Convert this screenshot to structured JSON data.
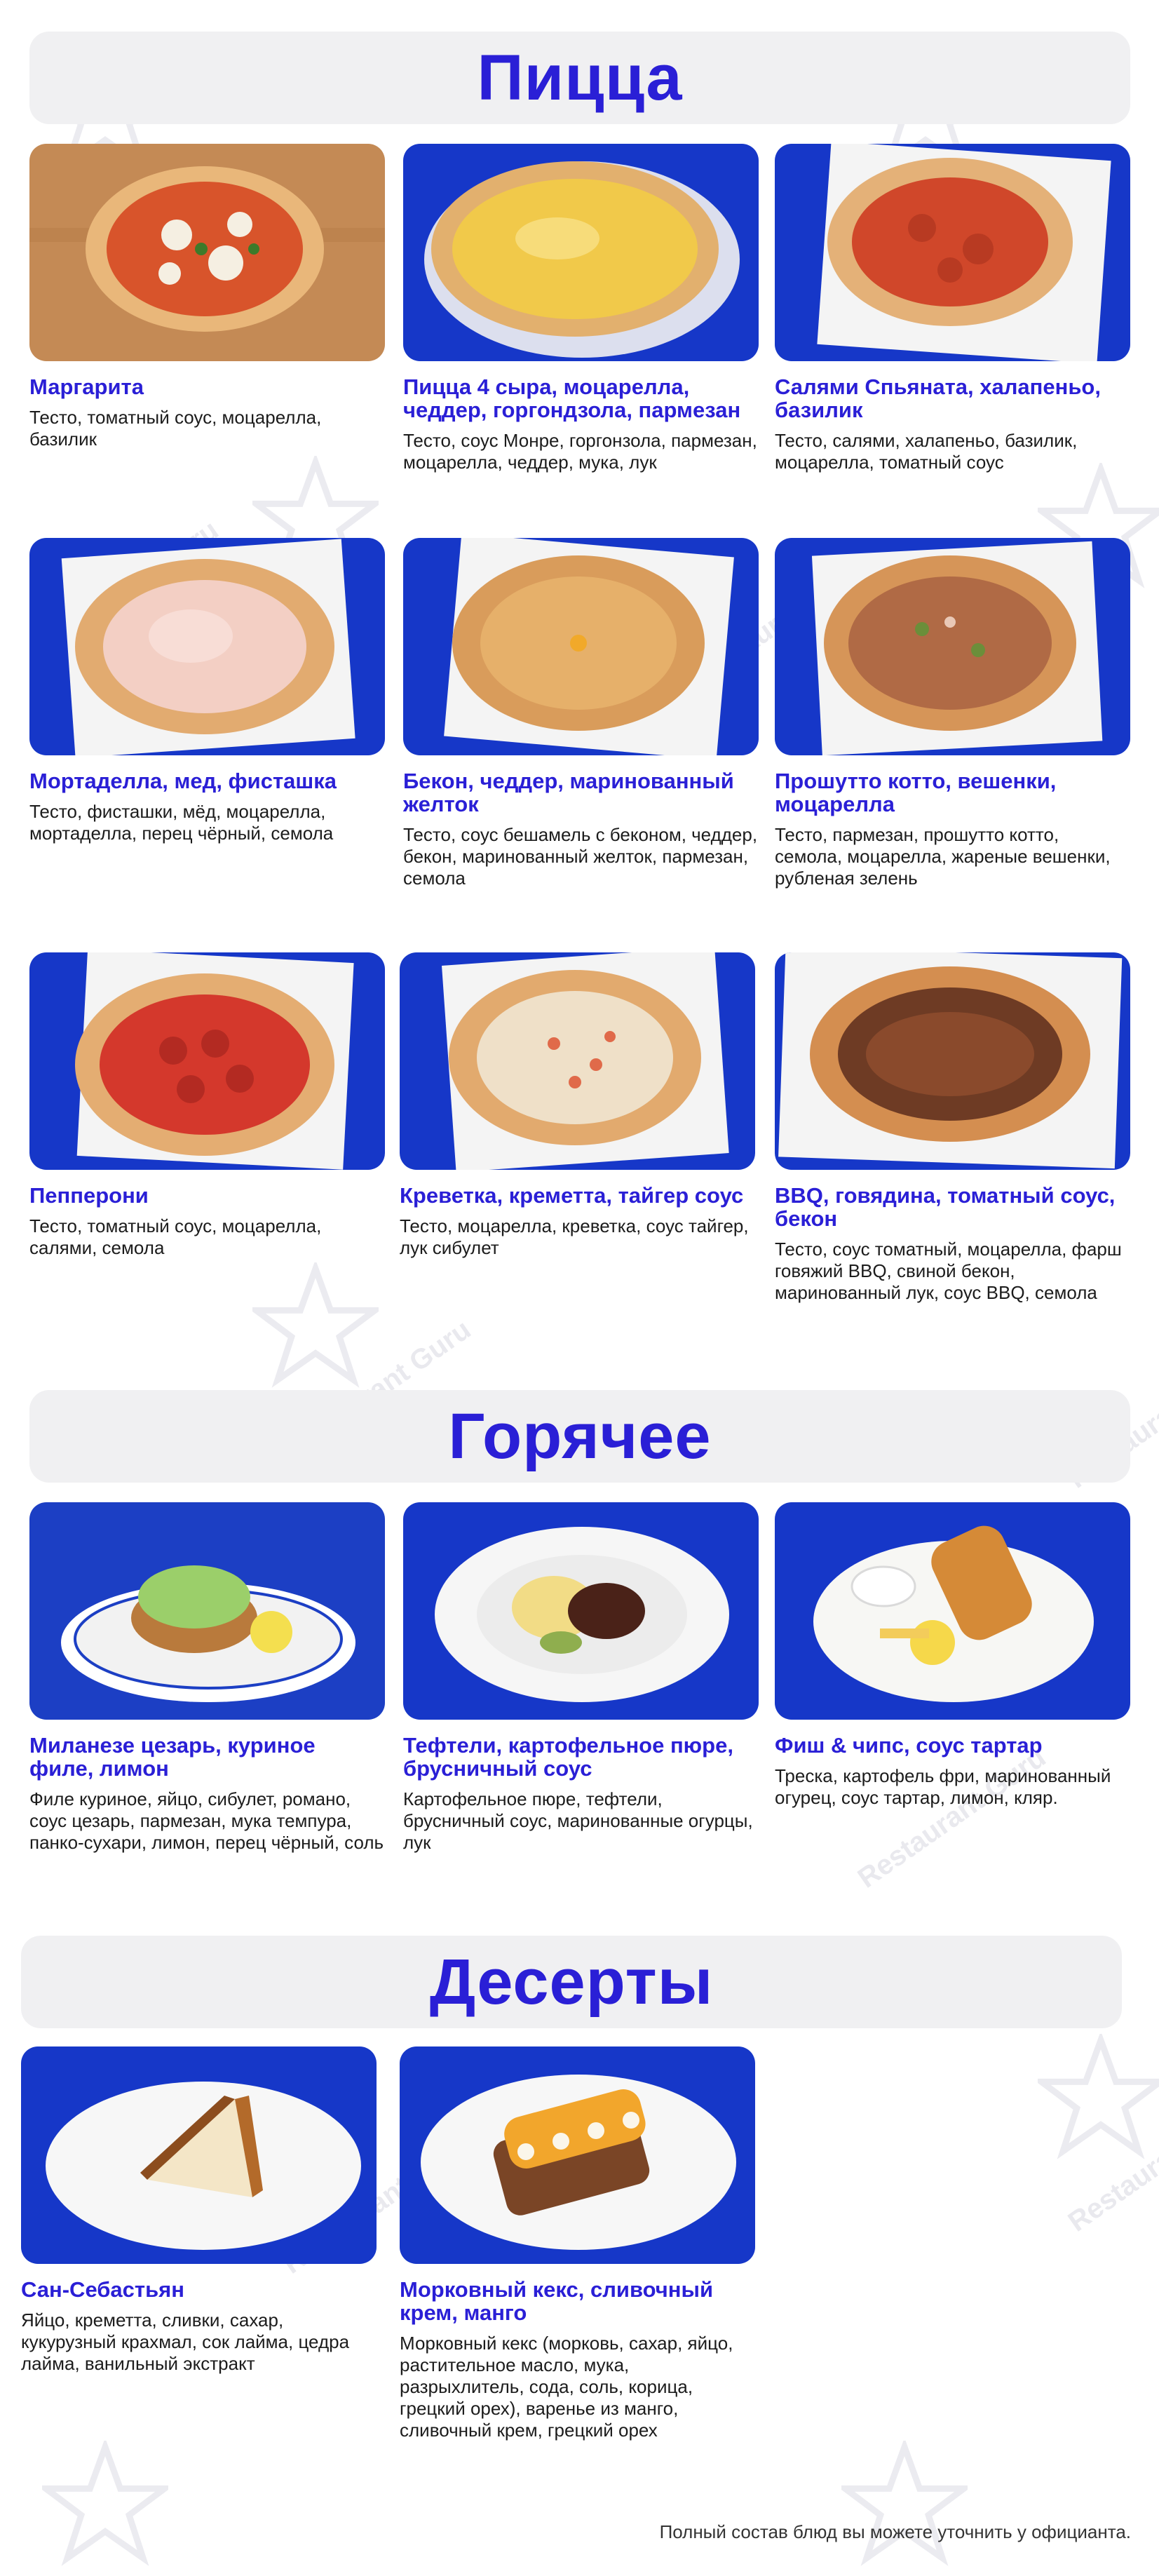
{
  "colors": {
    "accent": "#2a1fd6",
    "header_bg": "#f0f0f2",
    "photo_blue": "#1637c8",
    "text": "#1c1c1c"
  },
  "sections": [
    {
      "title": "Пицца",
      "items": [
        {
          "name": "Маргарита",
          "desc": "Тесто, томатный соус, моцарелла, базилик",
          "image": "pizza-margherita-photo"
        },
        {
          "name": "Пицца 4 сыра, моцарелла, чеддер, горгондзола, пармезан",
          "desc": "Тесто, соус Монре, горгонзола, пармезан, моцарелла, чеддер, мука, лук",
          "image": "pizza-four-cheese-photo"
        },
        {
          "name": "Салями Спьяната, халапеньо, базилик",
          "desc": "Тесто, салями, халапеньо, базилик, моцарелла, томатный соус",
          "image": "pizza-salami-photo"
        },
        {
          "name": "Мортаделла, мед, фисташка",
          "desc": "Тесто, фисташки, мёд, моцарелла, мортаделла, перец чёрный, семола",
          "image": "pizza-mortadella-photo"
        },
        {
          "name": "Бекон, чеддер, маринованный желток",
          "desc": "Тесто, соус бешамель с беконом, чеддер, бекон, маринованный желток, пармезан, семола",
          "image": "pizza-bacon-photo"
        },
        {
          "name": "Прошутто котто, вешенки, моцарелла",
          "desc": "Тесто, пармезан, прошутто котто, семола, моцарелла, жареные вешенки, рубленая зелень",
          "image": "pizza-prosciutto-photo"
        },
        {
          "name": "Пепперони",
          "desc": "Тесто, томатный соус, моцарелла, салями, семола",
          "image": "pizza-pepperoni-photo"
        },
        {
          "name": "Креветка, креметта, тайгер соус",
          "desc": "Тесто, моцарелла, креветка, соус тайгер, лук сибулет",
          "image": "pizza-shrimp-photo"
        },
        {
          "name": "BBQ, говядина, томатный соус, бекон",
          "desc": "Тесто, соус томатный, моцарелла, фарш говяжий BBQ, свиной бекон, маринованный лук, соус BBQ, семола",
          "image": "pizza-bbq-photo"
        }
      ]
    },
    {
      "title": "Горячее",
      "items": [
        {
          "name": "Миланезе цезарь, куриное филе, лимон",
          "desc": "Филе куриное, яйцо, сибулет, романо, соус цезарь, пармезан, мука темпура, панко-сухари, лимон, перец чёрный, соль",
          "image": "milanese-caesar-photo"
        },
        {
          "name": "Тефтели, картофельное пюре, брусничный соус",
          "desc": "Картофельное пюре, тефтели, брусничный соус, маринованные огурцы, лук",
          "image": "meatballs-photo"
        },
        {
          "name": "Фиш & чипс, соус тартар",
          "desc": "Треска, картофель фри, маринованный огурец, соус тартар, лимон, кляр.",
          "image": "fish-and-chips-photo"
        }
      ]
    },
    {
      "title": "Десерты",
      "items": [
        {
          "name": "Сан-Себастьян",
          "desc": "Яйцо, креметта, сливки, сахар, кукурузный крахмал, сок лайма, цедра лайма, ванильный экстракт",
          "image": "san-sebastian-cheesecake-photo"
        },
        {
          "name": "Морковный кекс, сливочный крем, манго",
          "desc": "Морковный кекс (морковь, сахар, яйцо, растительное масло, мука, разрыхлитель, сода, соль, корица, грецкий орех), варенье из манго, сливочный крем, грецкий орех",
          "image": "carrot-cake-photo"
        }
      ]
    }
  ],
  "watermark": "Restaurant Guru",
  "footer": "Полный состав блюд вы можете уточнить у официанта."
}
